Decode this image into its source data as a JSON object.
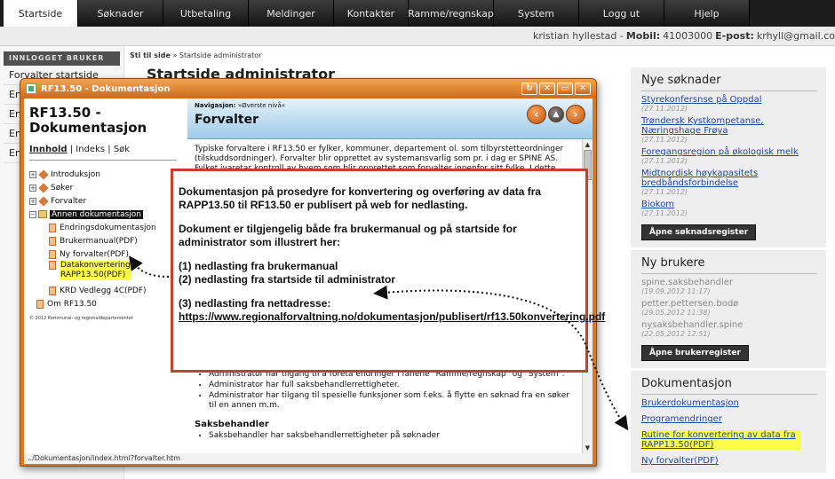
{
  "nav": {
    "tabs": [
      "Startside",
      "Søknader",
      "Utbetaling",
      "Meldinger",
      "Kontakter",
      "Ramme/regnskap",
      "System",
      "Logg ut",
      "Hjelp"
    ]
  },
  "userbar": {
    "name": "kristian hyllestad -",
    "mobile_label": "Mobil:",
    "mobile": "41003000",
    "email_label": "E-post:",
    "email": "krhyll@gmail.co"
  },
  "sidebar": {
    "header": "INNLOGGET BRUKER",
    "items": [
      "Forvalter startside",
      "En",
      "En",
      "En",
      "En"
    ]
  },
  "breadcrumb": {
    "home": "Sti til side",
    "sep": "»",
    "current": "Startside administrator"
  },
  "page_title": "Startside administrator",
  "popup": {
    "title": "RF13.50 - Dokumentasjon",
    "doc_title_line1": "RF13.50 -",
    "doc_title_line2": "Dokumentasjon",
    "tabs": {
      "active": "Innhold",
      "index": "Indeks",
      "search": "Søk"
    },
    "tree": {
      "introduksjon": "Introduksjon",
      "soker": "Søker",
      "forvalter": "Forvalter",
      "annen": "Annen dokumentasjon",
      "endrings": "Endringsdokumentasjon",
      "brukermanual": "Brukermanual(PDF)",
      "nyforvalter": "Ny forvalter(PDF)",
      "datakonv1": "Datakonvertering",
      "datakonv2": "RAPP13.50(PDF)",
      "krd": "KRD Vedlegg 4C(PDF)",
      "om": "Om RF13.50"
    },
    "copyright": "© 2012 Kommunal- og regionaldepartementet",
    "nav_label": "Navigasjon:",
    "nav_path": "»Øverste nivå«",
    "page_heading": "Forvalter",
    "intro_text": "Typiske forvaltere i RF13.50 er fylker, kommuner, departement ol. som tilbyrstetteordninger (tilskuddsordninger). Forvalter blir opprettet av systemansvarlig som pr. i dag er SPINE AS. Fylket ivaretar kontroll av hvem som blir opprettet som forvalter innenfor sitt fylke. I dette kapittel beskriver vi",
    "bullets": [
      "Administrator har tilgang til å foreta endringer i fanene \"Ramme/regnskap\" og \"System\".",
      "Administrator har full saksbehandlerrettigheter.",
      "Administrator har tilgang til spesielle funksjoner som f.eks. å flytte en søknad fra en søker til en annen m.m."
    ],
    "section_heading": "Saksbehandler",
    "section_bullet": "Saksbehandler har saksbehandlerrettigheter på søknader",
    "status": "../Dokumentasjon/index.html?forvalter.htm",
    "win_buttons": [
      "↻",
      "✕",
      "▭",
      "✕"
    ]
  },
  "annotation": {
    "p1": "Dokumentasjon på prosedyre for konvertering og overføring av data fra RAPP13.50 til RF13.50 er publisert på web for nedlasting.",
    "p2": "Dokument er tilgjengelig både fra brukermanual og på startside for administrator som illustrert her:",
    "l1": "(1) nedlasting fra brukermanual",
    "l2": "(2) nedlasting fra startside til administrator",
    "l3": "(3) nedlasting fra nettadresse:",
    "url": "https://www.regionalforvaltning.no/dokumentasjon/publisert/rf13.50konvertering.pdf"
  },
  "right": {
    "nye_title": "Nye søknader",
    "soknader": [
      {
        "name": "Styrekonfersnse på Oppdal",
        "date": "(27.11.2012)"
      },
      {
        "name": "Trøndersk Kystkompetanse, Næringshage Frøya",
        "date": "(27.11.2012)"
      },
      {
        "name": "Foregangsregion på økologisk melk",
        "date": "(27.11.2012)"
      },
      {
        "name": "Midtnordisk høykapasitets bredbåndsforbindelse",
        "date": "(27.11.2012)"
      },
      {
        "name": "Biokom",
        "date": "(27.11.2012)"
      }
    ],
    "soknad_button": "Åpne søknadsregister",
    "brukere_title": "Ny brukere",
    "brukere": [
      {
        "name": "spine.saksbehandler",
        "date": "(19.09.2012 11:17)"
      },
      {
        "name": "petter.pettersen.bodø",
        "date": "(29.05.2012 11:38)"
      },
      {
        "name": "nysaksbehandler.spine",
        "date": "(22.05.2012 12:51)"
      }
    ],
    "bruker_button": "Åpne brukerregister",
    "dok_title": "Dokumentasjon",
    "dok_links": [
      "Brukerdokumentasjon",
      "Programendringer",
      "Rutine for konvertering av data fra RAPP13.50(PDF)",
      "Ny forvalter(PDF)"
    ]
  },
  "colors": {
    "accent": "#d97a23",
    "highlight": "#fbfb49",
    "annotation_border": "#c0442a",
    "link": "#2346a7"
  }
}
